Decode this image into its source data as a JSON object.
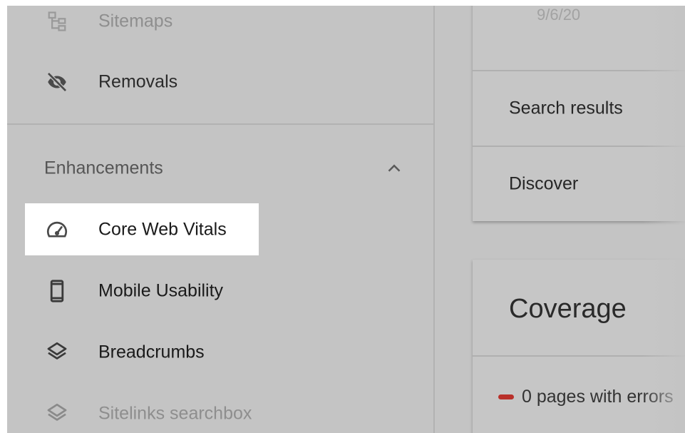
{
  "sidebar": {
    "items": [
      {
        "label": "Sitemaps",
        "icon": "sitemap-icon"
      },
      {
        "label": "Removals",
        "icon": "eye-off-icon"
      }
    ],
    "section": {
      "label": "Enhancements",
      "icon": "chevron-up-icon"
    },
    "section_items": [
      {
        "label": "Core Web Vitals",
        "icon": "speedometer-icon"
      },
      {
        "label": "Mobile Usability",
        "icon": "smartphone-icon"
      },
      {
        "label": "Breadcrumbs",
        "icon": "layers-icon"
      },
      {
        "label": "Sitelinks searchbox",
        "icon": "layers-icon"
      }
    ]
  },
  "main": {
    "performance_card": {
      "date": "9/6/20",
      "rows": [
        "Search results",
        "Discover"
      ]
    },
    "coverage_card": {
      "title": "Coverage",
      "status_text": "0 pages with errors",
      "status_color": "#b9302a"
    }
  },
  "colors": {
    "overlay": "#c4c4c4",
    "highlight": "#ffffff"
  }
}
